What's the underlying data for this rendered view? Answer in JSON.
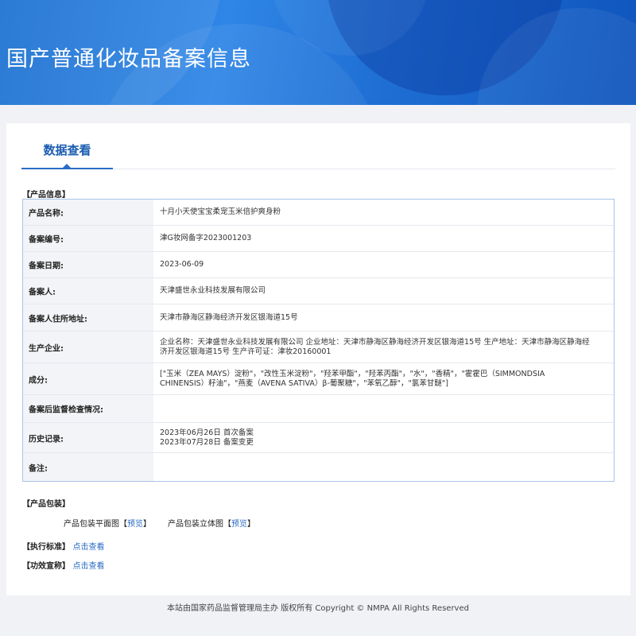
{
  "header": {
    "title": "国产普通化妆品备案信息"
  },
  "tabs": {
    "active": "数据查看"
  },
  "product_info": {
    "section_label": "【产品信息】",
    "rows": [
      {
        "label": "产品名称:",
        "value": "十月小天使宝宝柔宠玉米倍护爽身粉"
      },
      {
        "label": "备案编号:",
        "value": "津G妆网备字2023001203"
      },
      {
        "label": "备案日期:",
        "value": "2023-06-09"
      },
      {
        "label": "备案人:",
        "value": "天津盛世永业科技发展有限公司"
      },
      {
        "label": "备案人住所地址:",
        "value": "天津市静海区静海经济开发区银海道15号"
      },
      {
        "label": "生产企业:",
        "value": "企业名称：天津盛世永业科技发展有限公司 企业地址：天津市静海区静海经济开发区银海道15号 生产地址：天津市静海区静海经济开发区银海道15号 生产许可证：津妆20160001"
      },
      {
        "label": "成分:",
        "value": "[\"玉米（ZEA MAYS）淀粉\"，\"改性玉米淀粉\"，\"羟苯甲酯\"，\"羟苯丙酯\"，\"水\"，\"香精\"，\"霍霍巴（SIMMONDSIA CHINENSIS）籽油\"，\"燕麦（AVENA SATIVA）β-葡聚糖\"，\"苯氧乙醇\"，\"氯苯甘醚\"]"
      },
      {
        "label": "备案后监督检查情况:",
        "value": ""
      },
      {
        "label": "历史记录:",
        "value": "2023年06月26日 首次备案\n2023年07月28日 备案变更"
      },
      {
        "label": "备注:",
        "value": ""
      }
    ]
  },
  "packaging": {
    "section_label": "【产品包装】",
    "flat_label": "产品包装平面图",
    "solid_label": "产品包装立体图",
    "bracket_open": "【",
    "bracket_close": "】",
    "preview_label": "预览"
  },
  "standard": {
    "section_label": "【执行标准】",
    "link": "点击查看"
  },
  "efficacy": {
    "section_label": "【功效宣称】",
    "link": "点击查看"
  },
  "footer": {
    "text": "本站由国家药品监督管理局主办 版权所有 Copyright © NMPA All Rights Reserved"
  },
  "colors": {
    "accent": "#2a6bc5",
    "banner": "#1f6fd4",
    "table_border": "#a9c4e8"
  }
}
